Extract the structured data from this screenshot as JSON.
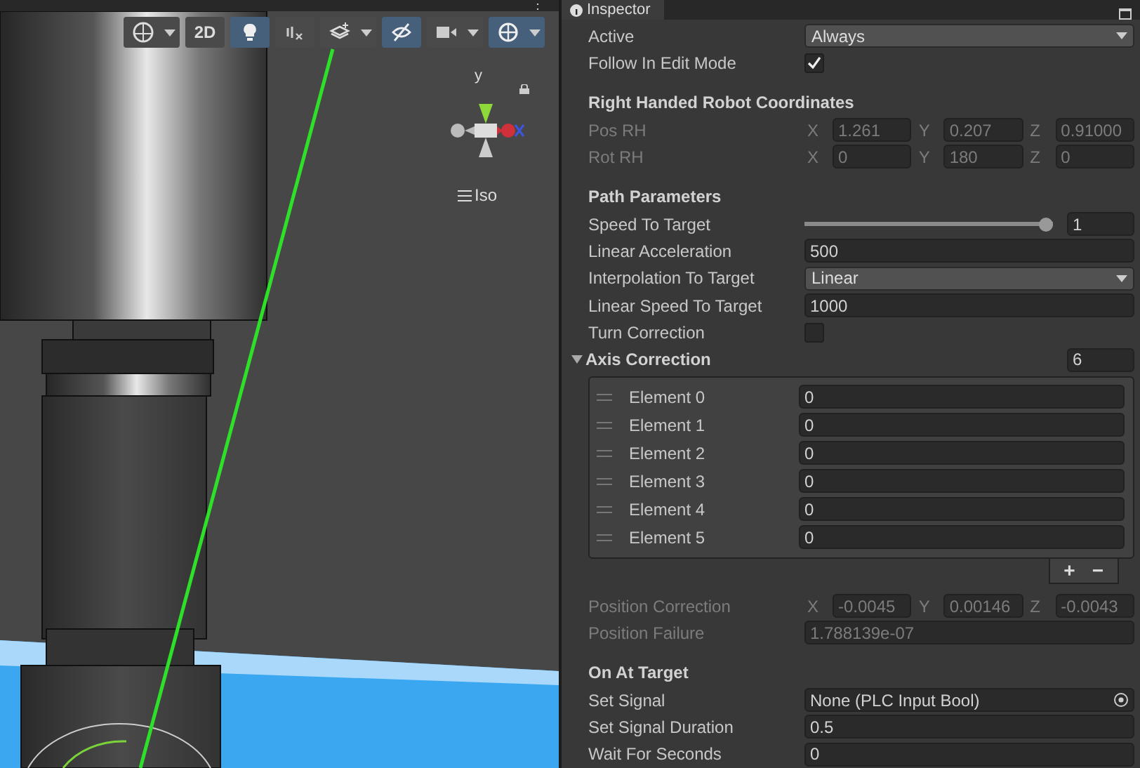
{
  "scene": {
    "menu_glyph": "⋮",
    "toolbar": [
      {
        "selected": false,
        "dropdown": true
      },
      {
        "label": "2D",
        "selected": false,
        "dropdown": false
      },
      {
        "selected": true,
        "dropdown": false
      },
      {
        "selected": false,
        "dropdown": false
      },
      {
        "selected": false,
        "dropdown": true
      },
      {
        "selected": true,
        "dropdown": false
      },
      {
        "selected": false,
        "dropdown": true
      },
      {
        "selected": true,
        "dropdown": true
      }
    ],
    "gizmo": {
      "axis_label": "y",
      "view_label": "Iso"
    }
  },
  "inspector": {
    "tab": "Inspector",
    "rows": [
      {
        "kind": "dropdown",
        "label": "Active",
        "value": "Always",
        "disabled": false
      },
      {
        "kind": "checkbox",
        "label": "Follow In Edit Mode",
        "checked": true,
        "disabled": false
      },
      {
        "kind": "header",
        "label": "Right Handed Robot Coordinates"
      },
      {
        "kind": "vector",
        "label": "Pos RH",
        "disabled": true,
        "axes": [
          {
            "axis": "X",
            "value": "1.261"
          },
          {
            "axis": "Y",
            "value": "0.207"
          },
          {
            "axis": "Z",
            "value": "0.91000"
          }
        ]
      },
      {
        "kind": "vector",
        "label": "Rot RH",
        "disabled": true,
        "axes": [
          {
            "axis": "X",
            "value": "0"
          },
          {
            "axis": "Y",
            "value": "180"
          },
          {
            "axis": "Z",
            "value": "0"
          }
        ]
      },
      {
        "kind": "header",
        "label": "Path Parameters"
      },
      {
        "kind": "slider",
        "label": "Speed To Target",
        "level": 1,
        "value": "1",
        "disabled": false
      },
      {
        "kind": "number",
        "label": "Linear Acceleration",
        "value": "500",
        "disabled": false
      },
      {
        "kind": "dropdown",
        "label": "Interpolation To Target",
        "value": "Linear",
        "disabled": false
      },
      {
        "kind": "number",
        "label": "Linear Speed To Target",
        "value": "1000",
        "disabled": false
      },
      {
        "kind": "checkbox",
        "label": "Turn Correction",
        "checked": false,
        "disabled": false
      },
      {
        "kind": "list",
        "label": "Axis Correction",
        "expanded": true,
        "count": "6",
        "add": "+",
        "remove": "−",
        "disabled": false,
        "items": [
          {
            "label": "Element 0",
            "value": "0"
          },
          {
            "label": "Element 1",
            "value": "0"
          },
          {
            "label": "Element 2",
            "value": "0"
          },
          {
            "label": "Element 3",
            "value": "0"
          },
          {
            "label": "Element 4",
            "value": "0"
          },
          {
            "label": "Element 5",
            "value": "0"
          }
        ]
      },
      {
        "kind": "vector",
        "label": "Position Correction",
        "disabled": true,
        "axes": [
          {
            "axis": "X",
            "value": "-0.0045"
          },
          {
            "axis": "Y",
            "value": "0.00146"
          },
          {
            "axis": "Z",
            "value": "-0.0043"
          }
        ]
      },
      {
        "kind": "number",
        "label": "Position Failure",
        "value": "1.788139e-07",
        "disabled": true
      },
      {
        "kind": "header",
        "label": "On At Target"
      },
      {
        "kind": "object",
        "label": "Set Signal",
        "value": "None (PLC Input Bool)",
        "disabled": false
      },
      {
        "kind": "number",
        "label": "Set Signal Duration",
        "value": "0.5",
        "disabled": false
      },
      {
        "kind": "number",
        "label": "Wait For Seconds",
        "value": "0",
        "disabled": false
      }
    ]
  }
}
